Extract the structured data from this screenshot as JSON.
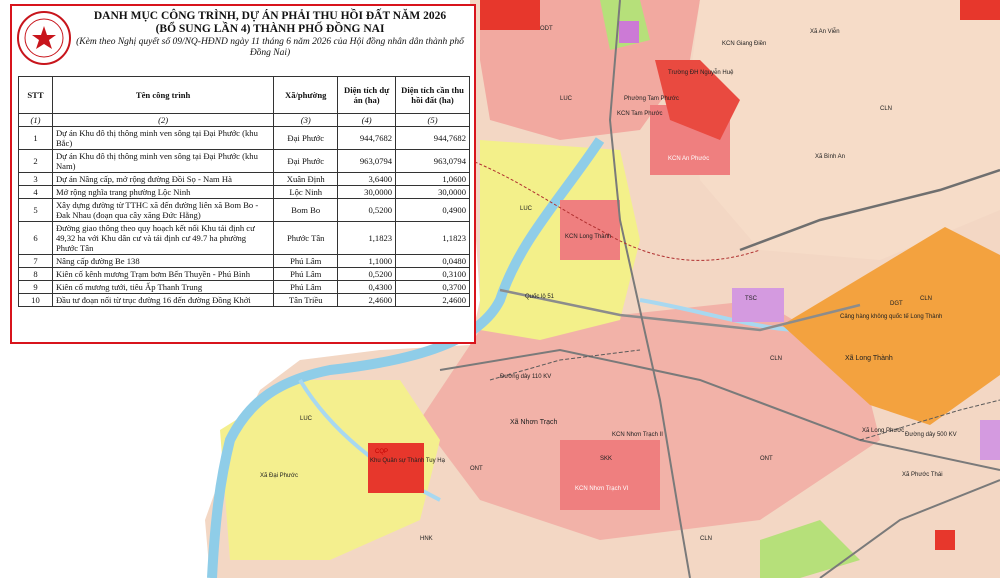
{
  "colors": {
    "land_residential": "#f2a9a0",
    "land_agri": "#f3f08a",
    "land_water": "#a8d8f0",
    "land_industrial": "#ef7f7f",
    "land_airport": "#f3a23f",
    "land_forest": "#b6e07a",
    "panel_border": "#d8141c",
    "seal": "#c8151c"
  },
  "panel": {
    "seal_icon": "state-emblem",
    "title_line1": "DANH MỤC CÔNG TRÌNH, DỰ ÁN PHẢI THU HỒI ĐẤT NĂM 2026",
    "title_line2": "(BỔ SUNG LẦN 4) THÀNH PHỐ ĐỒNG NAI",
    "subtitle": "(Kèm theo Nghị quyết số 09/NQ-HĐND ngày 11 tháng 6 năm 2026 của Hội đồng nhân dân thành phố Đồng Nai)",
    "headers": [
      "STT",
      "Tên công trình",
      "Xã/phường",
      "Diện tích dự án (ha)",
      "Diện tích cần thu hồi đất (ha)"
    ],
    "index_row": [
      "(1)",
      "(2)",
      "(3)",
      "(4)",
      "(5)"
    ],
    "rows": [
      {
        "stt": "1",
        "name": "Dự án Khu đô thị thông minh ven sông tại Đại Phước (khu Bắc)",
        "ward": "Đại Phước",
        "area": "944,7682",
        "recover": "944,7682"
      },
      {
        "stt": "2",
        "name": "Dự án Khu đô thị thông minh ven sông tại Đại Phước (khu Nam)",
        "ward": "Đại Phước",
        "area": "963,0794",
        "recover": "963,0794"
      },
      {
        "stt": "3",
        "name": "Dự án Nâng cấp, mở rộng đường Đồi Sọ - Nam Hà",
        "ward": "Xuân Định",
        "area": "3,6400",
        "recover": "1,0600"
      },
      {
        "stt": "4",
        "name": "Mở rộng nghĩa trang phường Lộc Ninh",
        "ward": "Lộc Ninh",
        "area": "30,0000",
        "recover": "30,0000"
      },
      {
        "stt": "5",
        "name": "Xây dựng đường từ TTHC xã đến đường liên xã Bom Bo - Đak Nhau (đoạn qua cây xăng Đức Hằng)",
        "ward": "Bom Bo",
        "area": "0,5200",
        "recover": "0,4900"
      },
      {
        "stt": "6",
        "name": "Đường giao thông theo quy hoạch kết nối Khu tái định cư 49,32 ha với Khu dân cư và tái định cư 49.7 ha phường Phước Tân",
        "ward": "Phước Tân",
        "area": "1,1823",
        "recover": "1,1823"
      },
      {
        "stt": "7",
        "name": "Nâng cấp đường Be 138",
        "ward": "Phú Lâm",
        "area": "1,1000",
        "recover": "0,0480"
      },
      {
        "stt": "8",
        "name": "Kiên cố kênh mương Trạm bơm Bến Thuyền - Phú Bình",
        "ward": "Phú Lâm",
        "area": "0,5200",
        "recover": "0,3100"
      },
      {
        "stt": "9",
        "name": "Kiên cố mương tưới, tiêu Ấp Thanh Trung",
        "ward": "Phú Lâm",
        "area": "0,4300",
        "recover": "0,3700"
      },
      {
        "stt": "10",
        "name": "Đầu tư đoạn nối từ trục đường 16 đến đường Đồng Khởi",
        "ward": "Tân Triều",
        "area": "2,4600",
        "recover": "2,4600"
      }
    ]
  },
  "map": {
    "labels": {
      "airport": "Cảng hàng không quốc tế Long Thành",
      "xa_long_thanh": "Xã Long Thành",
      "xa_nhon_trach": "Xã Nhơn Trạch",
      "xa_dai_phuoc": "Xã Đại Phước",
      "kcn_nhon_trach_ii": "KCN Nhơn Trạch II",
      "kcn_nhon_trach_vi": "KCN Nhơn Trạch VI",
      "kcn_long_thanh": "KCN Long Thành",
      "kcn_tam_phuoc": "KCN Tam Phước",
      "kcn_giang_dien": "KCN Giang Điền",
      "kcn_an_phuoc": "KCN An Phước",
      "khu_quan_su": "Khu Quân sự Thành Tuy Hạ",
      "xa_binh_an": "Xã Bình An",
      "xa_phuoc_thai": "Xã Phước Thái",
      "xa_an_vien": "Xã An Viễn",
      "xa_long_phuoc": "Xã Long Phước",
      "phuong_tam_phuoc": "Phường Tam Phước",
      "truong_dh_nguyen_hue": "Trường ĐH Nguyễn Huệ",
      "cln": "CLN",
      "luc": "LUC",
      "skk": "SKK",
      "ont": "ONT",
      "odt": "ODT",
      "hnk": "HNK",
      "dgt": "DGT",
      "cqp": "CQP",
      "tsc": "TSC",
      "road_ql51": "Quốc lộ 51",
      "road_110kv": "Đường dây 110 KV",
      "road_500kv": "Đường dây 500 KV"
    }
  }
}
